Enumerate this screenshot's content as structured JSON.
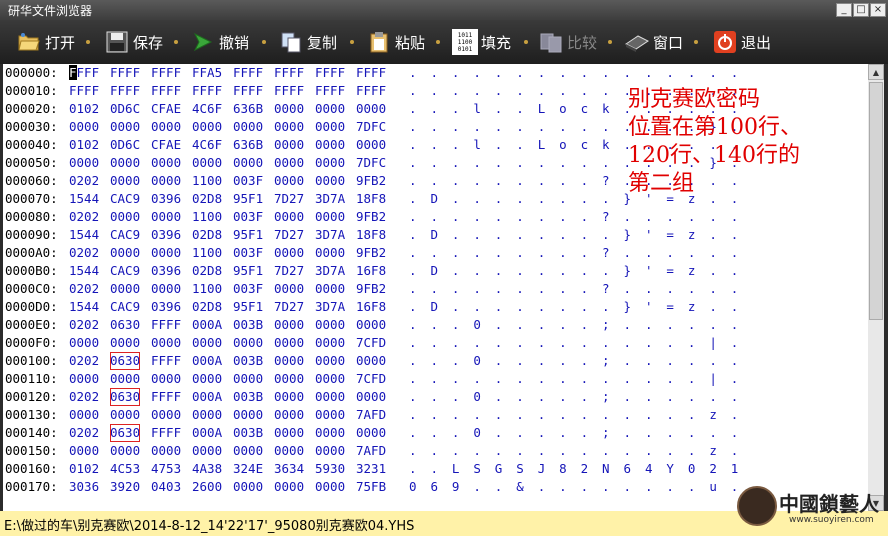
{
  "window": {
    "title": "研华文件浏览器",
    "min": "_",
    "max": "□",
    "close": "×"
  },
  "toolbar": {
    "open": "打开",
    "save": "保存",
    "undo": "撤销",
    "copy": "复制",
    "paste": "粘贴",
    "fill": "填充",
    "compare": "比较",
    "window": "窗口",
    "exit": "退出",
    "fill_icon_text": "1011\n1100\n0101"
  },
  "rows": [
    {
      "addr": "000000:",
      "hex": [
        "FFFF",
        "FFFF",
        "FFFF",
        "FFA5",
        "FFFF",
        "FFFF",
        "FFFF",
        "FFFF"
      ],
      "ascii": ". . . . . . . . . . . . . . . ."
    },
    {
      "addr": "000010:",
      "hex": [
        "FFFF",
        "FFFF",
        "FFFF",
        "FFFF",
        "FFFF",
        "FFFF",
        "FFFF",
        "FFFF"
      ],
      "ascii": ". . . . . . . . . . . . . . . ."
    },
    {
      "addr": "000020:",
      "hex": [
        "0102",
        "0D6C",
        "CFAE",
        "4C6F",
        "636B",
        "0000",
        "0000",
        "0000"
      ],
      "ascii": ". . . l . . L o c k . . . . . ."
    },
    {
      "addr": "000030:",
      "hex": [
        "0000",
        "0000",
        "0000",
        "0000",
        "0000",
        "0000",
        "0000",
        "7DFC"
      ],
      "ascii": ". . . . . . . . . . . . . . } ."
    },
    {
      "addr": "000040:",
      "hex": [
        "0102",
        "0D6C",
        "CFAE",
        "4C6F",
        "636B",
        "0000",
        "0000",
        "0000"
      ],
      "ascii": ". . . l . . L o c k . . . . . ."
    },
    {
      "addr": "000050:",
      "hex": [
        "0000",
        "0000",
        "0000",
        "0000",
        "0000",
        "0000",
        "0000",
        "7DFC"
      ],
      "ascii": ". . . . . . . . . . . . . . } ."
    },
    {
      "addr": "000060:",
      "hex": [
        "0202",
        "0000",
        "0000",
        "1100",
        "003F",
        "0000",
        "0000",
        "9FB2"
      ],
      "ascii": ". . . . . . . . . ? . . . . . ."
    },
    {
      "addr": "000070:",
      "hex": [
        "1544",
        "CAC9",
        "0396",
        "02D8",
        "95F1",
        "7D27",
        "3D7A",
        "18F8"
      ],
      "ascii": ". D . . . . . . . . } ' = z . ."
    },
    {
      "addr": "000080:",
      "hex": [
        "0202",
        "0000",
        "0000",
        "1100",
        "003F",
        "0000",
        "0000",
        "9FB2"
      ],
      "ascii": ". . . . . . . . . ? . . . . . ."
    },
    {
      "addr": "000090:",
      "hex": [
        "1544",
        "CAC9",
        "0396",
        "02D8",
        "95F1",
        "7D27",
        "3D7A",
        "18F8"
      ],
      "ascii": ". D . . . . . . . . } ' = z . ."
    },
    {
      "addr": "0000A0:",
      "hex": [
        "0202",
        "0000",
        "0000",
        "1100",
        "003F",
        "0000",
        "0000",
        "9FB2"
      ],
      "ascii": ". . . . . . . . . ? . . . . . ."
    },
    {
      "addr": "0000B0:",
      "hex": [
        "1544",
        "CAC9",
        "0396",
        "02D8",
        "95F1",
        "7D27",
        "3D7A",
        "16F8"
      ],
      "ascii": ". D . . . . . . . . } ' = z . ."
    },
    {
      "addr": "0000C0:",
      "hex": [
        "0202",
        "0000",
        "0000",
        "1100",
        "003F",
        "0000",
        "0000",
        "9FB2"
      ],
      "ascii": ". . . . . . . . . ? . . . . . ."
    },
    {
      "addr": "0000D0:",
      "hex": [
        "1544",
        "CAC9",
        "0396",
        "02D8",
        "95F1",
        "7D27",
        "3D7A",
        "16F8"
      ],
      "ascii": ". D . . . . . . . . } ' = z . ."
    },
    {
      "addr": "0000E0:",
      "hex": [
        "0202",
        "0630",
        "FFFF",
        "000A",
        "003B",
        "0000",
        "0000",
        "0000"
      ],
      "ascii": ". . . 0 . . . . . ; . . . . . ."
    },
    {
      "addr": "0000F0:",
      "hex": [
        "0000",
        "0000",
        "0000",
        "0000",
        "0000",
        "0000",
        "0000",
        "7CFD"
      ],
      "ascii": ". . . . . . . . . . . . . . | ."
    },
    {
      "addr": "000100:",
      "hex": [
        "0202",
        "0630",
        "FFFF",
        "000A",
        "003B",
        "0000",
        "0000",
        "0000"
      ],
      "ascii": ". . . 0 . . . . . ; . . . . . ."
    },
    {
      "addr": "000110:",
      "hex": [
        "0000",
        "0000",
        "0000",
        "0000",
        "0000",
        "0000",
        "0000",
        "7CFD"
      ],
      "ascii": ". . . . . . . . . . . . . . | ."
    },
    {
      "addr": "000120:",
      "hex": [
        "0202",
        "0630",
        "FFFF",
        "000A",
        "003B",
        "0000",
        "0000",
        "0000"
      ],
      "ascii": ". . . 0 . . . . . ; . . . . . ."
    },
    {
      "addr": "000130:",
      "hex": [
        "0000",
        "0000",
        "0000",
        "0000",
        "0000",
        "0000",
        "0000",
        "7AFD"
      ],
      "ascii": ". . . . . . . . . . . . . . z ."
    },
    {
      "addr": "000140:",
      "hex": [
        "0202",
        "0630",
        "FFFF",
        "000A",
        "003B",
        "0000",
        "0000",
        "0000"
      ],
      "ascii": ". . . 0 . . . . . ; . . . . . ."
    },
    {
      "addr": "000150:",
      "hex": [
        "0000",
        "0000",
        "0000",
        "0000",
        "0000",
        "0000",
        "0000",
        "7AFD"
      ],
      "ascii": ". . . . . . . . . . . . . . z ."
    },
    {
      "addr": "000160:",
      "hex": [
        "0102",
        "4C53",
        "4753",
        "4A38",
        "324E",
        "3634",
        "5930",
        "3231"
      ],
      "ascii": ". . L S G S J 8 2 N 6 4 Y 0 2 1"
    },
    {
      "addr": "000170:",
      "hex": [
        "3036",
        "3920",
        "0403",
        "2600",
        "0000",
        "0000",
        "0000",
        "75FB"
      ],
      "ascii": "0 6 9 . . & . . . . . . . . u ."
    }
  ],
  "cursor": {
    "row": 0,
    "col": 0
  },
  "highlights": [
    {
      "row": 16,
      "col": 1
    },
    {
      "row": 18,
      "col": 1
    },
    {
      "row": 20,
      "col": 1
    }
  ],
  "annotation": [
    "别克赛欧密码",
    "位置在第100行、",
    "120行、140行的",
    "第二组"
  ],
  "status": {
    "path": "E:\\做过的车\\别克赛欧\\2014-8-12_14'22'17'_95080别克赛欧04.YHS"
  },
  "watermark": {
    "text": "中國鎖藝人",
    "url": "www.suoyiren.com"
  },
  "colors": {
    "hex_text": "#1515b8",
    "annotation": "#e00000",
    "status_bg": "#fff2a8"
  }
}
